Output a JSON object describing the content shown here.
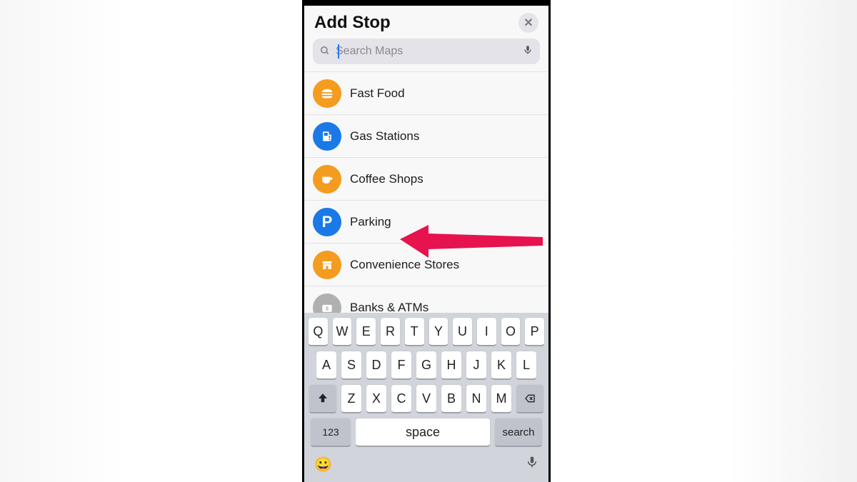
{
  "header": {
    "title": "Add Stop"
  },
  "search": {
    "placeholder": "Search Maps"
  },
  "categories": [
    {
      "label": "Fast Food",
      "icon": "burger",
      "color": "orange"
    },
    {
      "label": "Gas Stations",
      "icon": "pump",
      "color": "blue"
    },
    {
      "label": "Coffee Shops",
      "icon": "cup",
      "color": "orange"
    },
    {
      "label": "Parking",
      "icon": "P",
      "color": "blue"
    },
    {
      "label": "Convenience Stores",
      "icon": "store",
      "color": "orange"
    },
    {
      "label": "Banks & ATMs",
      "icon": "bank",
      "color": "grey"
    }
  ],
  "keyboard": {
    "row1": [
      "Q",
      "W",
      "E",
      "R",
      "T",
      "Y",
      "U",
      "I",
      "O",
      "P"
    ],
    "row2": [
      "A",
      "S",
      "D",
      "F",
      "G",
      "H",
      "J",
      "K",
      "L"
    ],
    "row3": [
      "Z",
      "X",
      "C",
      "V",
      "B",
      "N",
      "M"
    ],
    "numLabel": "123",
    "spaceLabel": "space",
    "searchLabel": "search"
  },
  "annotation": {
    "target": "Parking"
  }
}
